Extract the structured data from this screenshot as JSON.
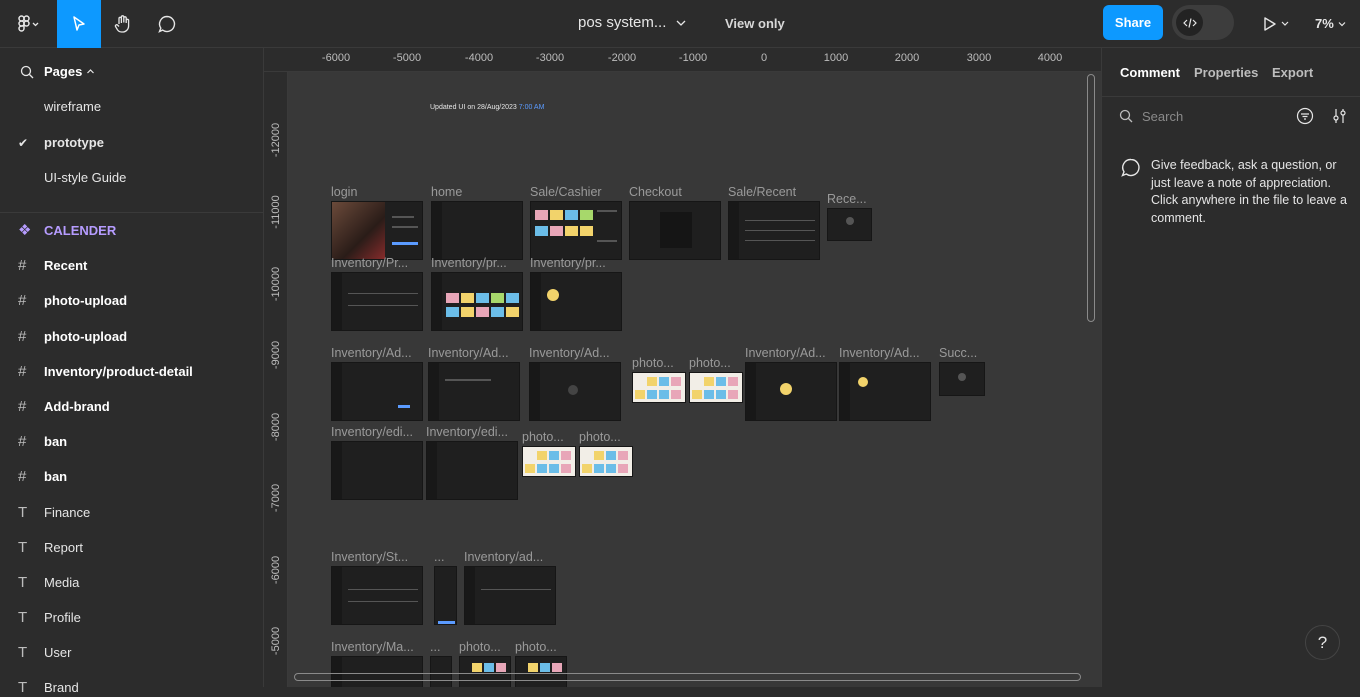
{
  "topbar": {
    "file_title": "pos system...",
    "view_mode": "View only",
    "share_label": "Share",
    "zoom": "7%"
  },
  "pages": {
    "header": "Pages",
    "items": [
      {
        "label": "wireframe",
        "selected": false
      },
      {
        "label": "prototype",
        "selected": true
      },
      {
        "label": "UI-style Guide",
        "selected": false
      }
    ]
  },
  "layers": [
    {
      "label": "CALENDER",
      "kind": "component"
    },
    {
      "label": "Recent",
      "kind": "frame"
    },
    {
      "label": "photo-upload",
      "kind": "frame"
    },
    {
      "label": "photo-upload",
      "kind": "frame"
    },
    {
      "label": "Inventory/product-detail",
      "kind": "frame"
    },
    {
      "label": "Add-brand",
      "kind": "frame"
    },
    {
      "label": "ban",
      "kind": "frame"
    },
    {
      "label": "ban",
      "kind": "frame"
    },
    {
      "label": "Finance",
      "kind": "text"
    },
    {
      "label": "Report",
      "kind": "text"
    },
    {
      "label": "Media",
      "kind": "text"
    },
    {
      "label": "Profile",
      "kind": "text"
    },
    {
      "label": "User",
      "kind": "text"
    },
    {
      "label": "Brand",
      "kind": "text"
    }
  ],
  "rulers": {
    "top": [
      "-6000",
      "-5000",
      "-4000",
      "-3000",
      "-2000",
      "-1000",
      "0",
      "1000",
      "2000",
      "3000",
      "4000"
    ],
    "left": [
      "-12000",
      "-11000",
      "-10000",
      "-9000",
      "-8000",
      "-7000",
      "-6000",
      "-5000"
    ]
  },
  "canvas": {
    "updated_text": "Updated UI on 28/Aug/2023",
    "updated_time": "7:00 AM",
    "frames": [
      "login",
      "home",
      "Sale/Cashier",
      "Checkout",
      "Sale/Recent",
      "Rece...",
      "Inventory/Pr...",
      "Inventory/pr...",
      "Inventory/pr...",
      "Inventory/Ad...",
      "Inventory/Ad...",
      "Inventory/Ad...",
      "photo...",
      "photo...",
      "Inventory/Ad...",
      "Inventory/Ad...",
      "Succ...",
      "Inventory/edi...",
      "Inventory/edi...",
      "photo...",
      "photo...",
      "Inventory/St...",
      "...",
      "Inventory/ad...",
      "Inventory/Ma...",
      "...",
      "photo...",
      "photo..."
    ]
  },
  "right_panel": {
    "tabs": [
      "Comment",
      "Properties",
      "Export"
    ],
    "search_placeholder": "Search",
    "empty_message": "Give feedback, ask a question, or just leave a note of appreciation. Click anywhere in the file to leave a comment."
  },
  "help_label": "?",
  "colors": {
    "accent": "#0d99ff",
    "component": "#b69cff",
    "panel": "#2c2c2c",
    "canvas": "#383838"
  }
}
